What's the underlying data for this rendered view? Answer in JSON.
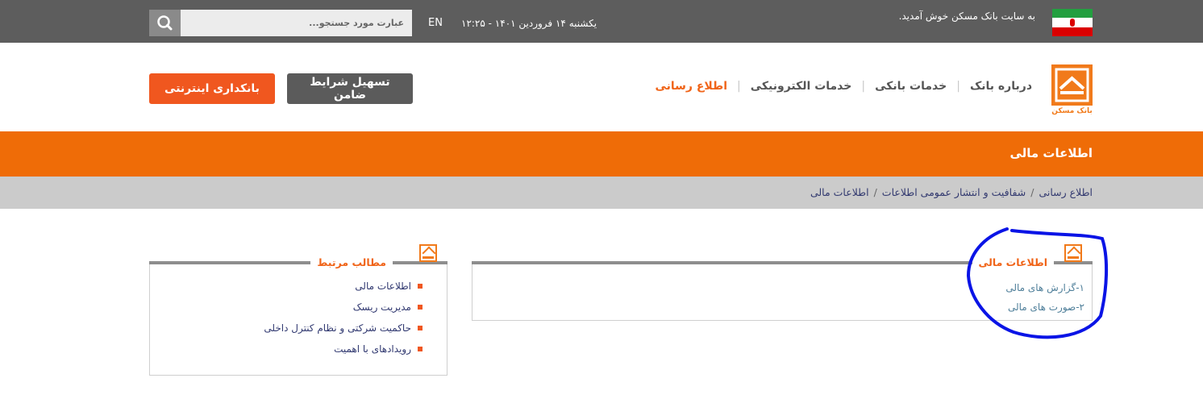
{
  "topbar": {
    "welcome": "به سایت بانک مسکن خوش آمدید.",
    "datetime": "یکشنبه ۱۴ فروردین ۱۴۰۱ - ۱۲:۲۵",
    "lang": "EN",
    "search_placeholder": "عبارت مورد جستجو...",
    "search_icon": "search-icon",
    "flag_icon": "iran-flag-icon"
  },
  "header": {
    "logo_caption": "بانک مسکن",
    "nav": [
      "درباره بانک",
      "خدمات بانکی",
      "خدمات الکترونیکی",
      "اطلاع رسانی"
    ],
    "btn_guarantor": "تسهیل شرایط ضامن",
    "btn_internet": "بانکداری اینترنتی"
  },
  "page_title": "اطلاعات مالی",
  "breadcrumb": [
    "اطلاع رسانی",
    "شفافیت و انتشار عمومی اطلاعات",
    "اطلاعات مالی"
  ],
  "main_panel": {
    "title": "اطلاعات مالی",
    "items": [
      "۱-گزارش های مالی",
      "۲-صورت های مالی"
    ]
  },
  "side_panel": {
    "title": "مطالب مرتبط",
    "items": [
      "اطلاعات مالی",
      "مدیریت ریسک",
      "حاکمیت شرکتی و نظام کنترل داخلی",
      "رویدادهای با اهمیت"
    ]
  },
  "colors": {
    "accent_orange": "#ef6c07",
    "button_orange": "#f0571f",
    "topbar_gray": "#5d5d5d",
    "annotation_blue": "#0a14e6"
  }
}
